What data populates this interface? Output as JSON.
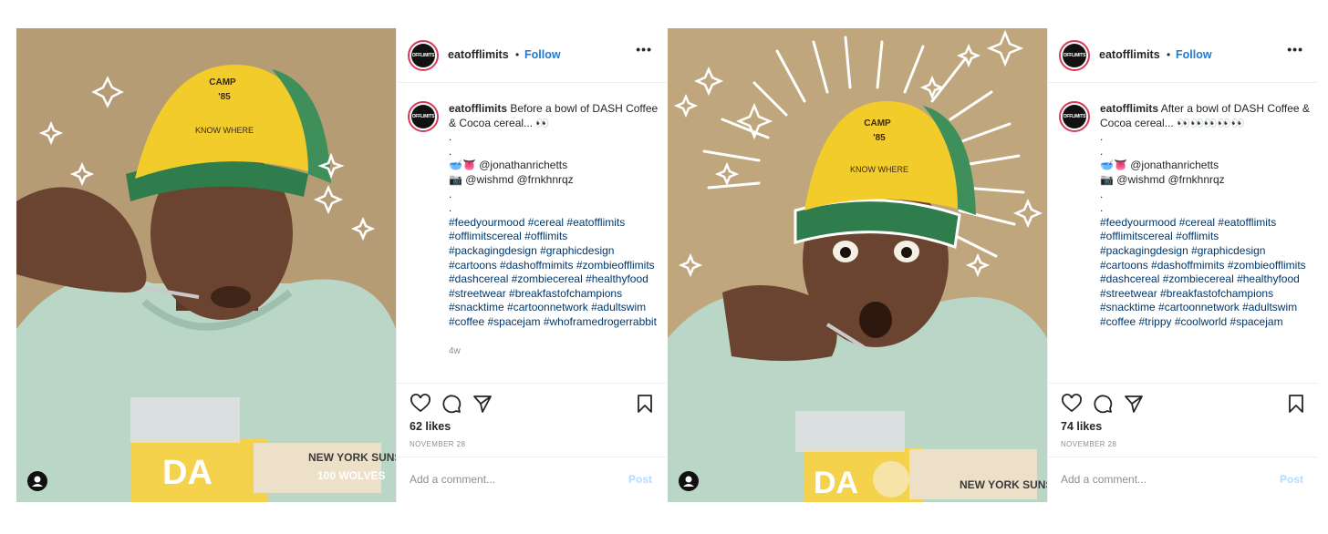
{
  "posts": [
    {
      "username": "eatofflimits",
      "avatar_text": "OFFLIMITS",
      "follow_label": "Follow",
      "dot": "•",
      "more_label": "•••",
      "caption_text": "Before a bowl of DASH Coffee & Cocoa cereal... 👀",
      "caption_body": ".\n.\n🥣👅 @jonathanrichetts\n📷 @wishmd @frnkhnrqz\n.\n.",
      "hashtags": "#feedyourmood #cereal #eatofflimits #offlimitscereal #offlimits #packagingdesign #graphicdesign #cartoons #dashoffmimits #zombieofflimits #dashcereal #zombiecereal #healthyfood #streetwear #breakfastofchampions #snacktime #cartoonnetwork #adultswim #coffee #spacejam #whoframedrogerrabbit",
      "age": "4w",
      "likes": "62 likes",
      "date": "NOVEMBER 28",
      "comment_placeholder": "Add a comment...",
      "post_label": "Post"
    },
    {
      "username": "eatofflimits",
      "avatar_text": "OFFLIMITS",
      "follow_label": "Follow",
      "dot": "•",
      "more_label": "•••",
      "caption_text": "After a bowl of DASH Coffee & Cocoa cereal... 👀👀👀👀👀",
      "caption_body": ".\n.\n🥣👅 @jonathanrichetts\n📷 @wishmd @frnkhnrqz\n.\n.",
      "hashtags": "#feedyourmood #cereal #eatofflimits #offlimitscereal #offlimits #packagingdesign #graphicdesign #cartoons #dashoffmimits #zombieofflimits #dashcereal #zombiecereal #healthyfood #streetwear #breakfastofchampions #snacktime #cartoonnetwork #adultswim #coffee #trippy #coolworld #spacejam",
      "age": "",
      "likes": "74 likes",
      "date": "NOVEMBER 28",
      "comment_placeholder": "Add a comment...",
      "post_label": "Post"
    }
  ],
  "photo_text": {
    "cap_line1": "CAMP",
    "cap_line2": "'85",
    "cap_line3": "KNOW WHERE",
    "box_brand": "DA",
    "box_side": "NEW YORK SUNSH",
    "box_side2": "100 WOLVES"
  },
  "colors": {
    "accent_blue": "#1b7bd6",
    "hashtag_blue": "#00376b",
    "post_disabled": "#b3dbff",
    "cap_yellow": "#f1cc2b",
    "cap_green": "#2f7d4c",
    "hoodie": "#b9d6c6",
    "background_photo1": "#b59c74",
    "background_photo2": "#bfa67c"
  },
  "icons": [
    "heart-icon",
    "comment-icon",
    "share-icon",
    "bookmark-icon",
    "more-icon",
    "user-tag-icon"
  ]
}
